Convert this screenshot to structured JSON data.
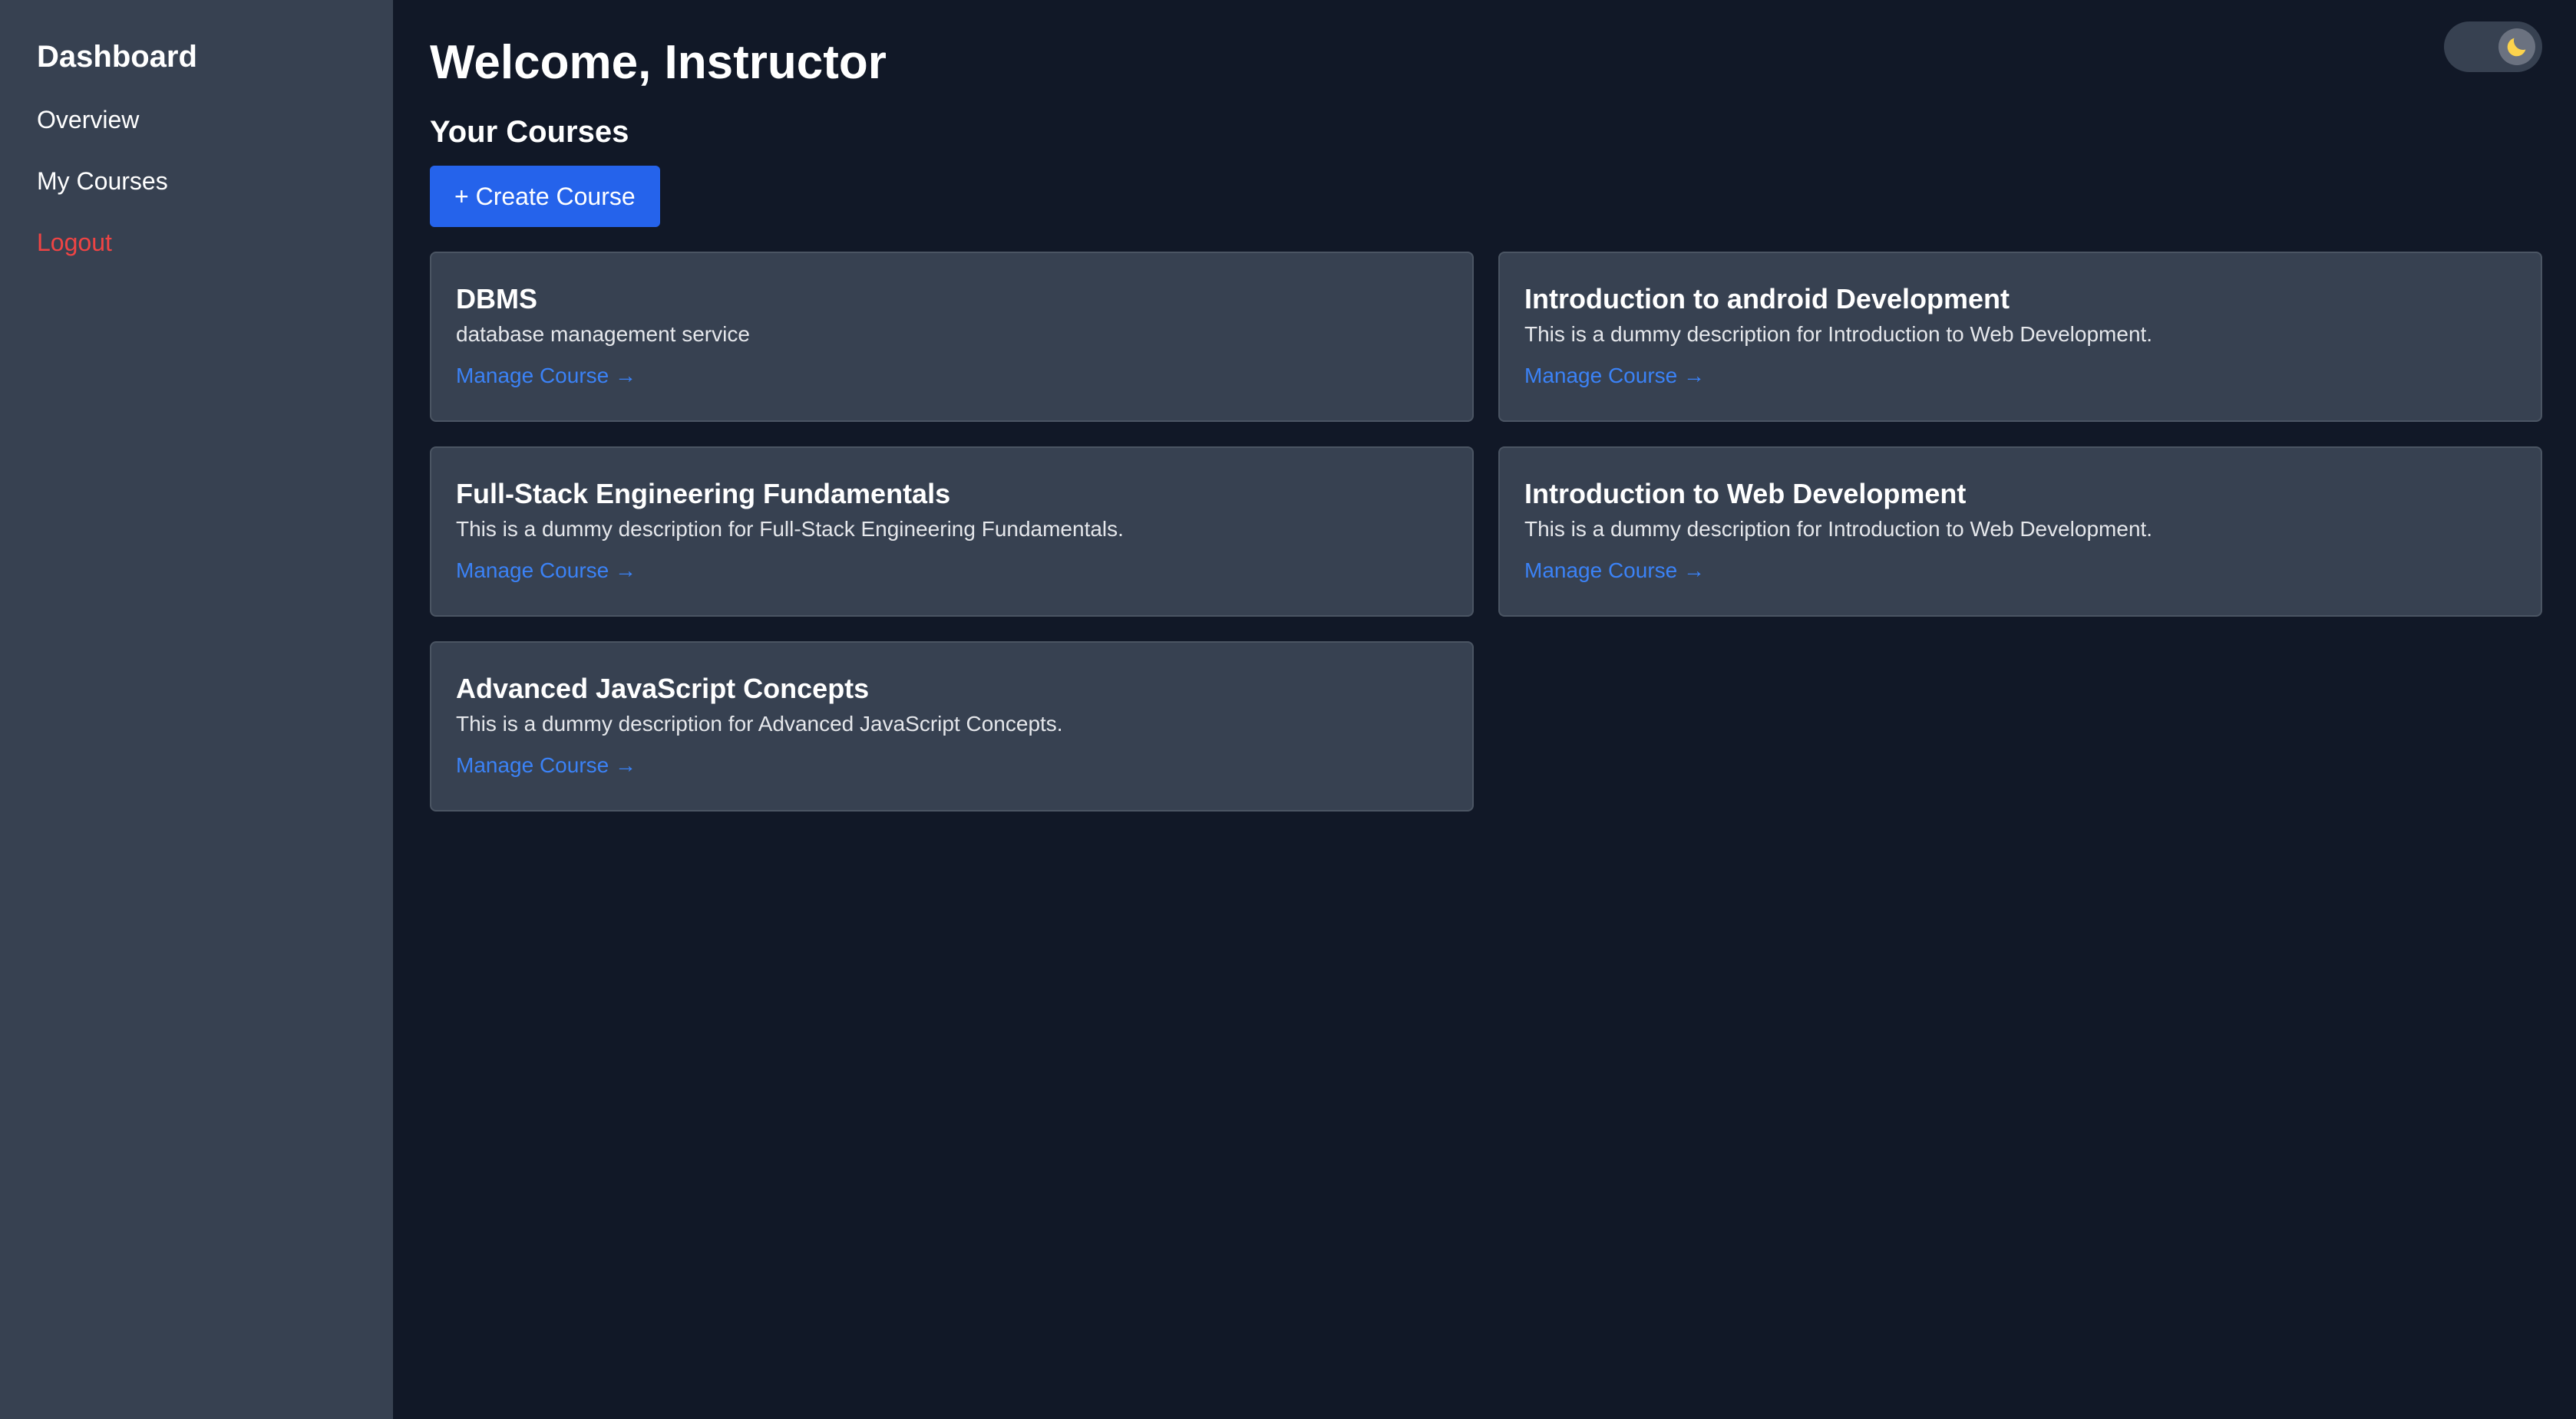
{
  "sidebar": {
    "title": "Dashboard",
    "items": [
      {
        "label": "Overview"
      },
      {
        "label": "My Courses"
      },
      {
        "label": "Logout"
      }
    ]
  },
  "header": {
    "title": "Welcome, Instructor"
  },
  "main": {
    "section_title": "Your Courses",
    "create_button_label": "+ Create Course",
    "courses": [
      {
        "title": "DBMS",
        "description": "database management service",
        "link": "Manage Course →"
      },
      {
        "title": "Introduction to android Development",
        "description": "This is a dummy description for Introduction to Web Development.",
        "link": "Manage Course →"
      },
      {
        "title": "Full-Stack Engineering Fundamentals",
        "description": "This is a dummy description for Full-Stack Engineering Fundamentals.",
        "link": "Manage Course →"
      },
      {
        "title": "Introduction to Web Development",
        "description": "This is a dummy description for Introduction to Web Development.",
        "link": "Manage Course →"
      },
      {
        "title": "Advanced JavaScript Concepts",
        "description": "This is a dummy description for Advanced JavaScript Concepts.",
        "link": "Manage Course →"
      }
    ]
  },
  "theme_toggle": {
    "icon": "moon-icon",
    "mode": "dark"
  },
  "colors": {
    "background": "#111827",
    "sidebar": "#374151",
    "card": "#374151",
    "accent": "#2563eb",
    "link": "#3b82f6",
    "logout": "#ef4444",
    "moon": "#fcd34d"
  }
}
